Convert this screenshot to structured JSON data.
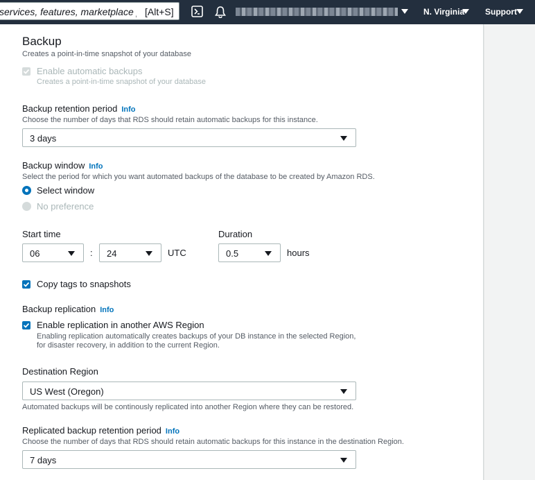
{
  "nav": {
    "search_text": "services, features, marketplace products",
    "search_shortcut": "[Alt+S]",
    "cloudshell_icon": "terminal-icon",
    "notifications_icon": "bell-icon",
    "region": "N. Virginia",
    "support": "Support"
  },
  "backup": {
    "title": "Backup",
    "description": "Creates a point-in-time snapshot of your database",
    "auto_backups": {
      "label": "Enable automatic backups",
      "description": "Creates a point-in-time snapshot of your database",
      "checked": true,
      "disabled": true
    },
    "retention": {
      "label": "Backup retention period",
      "info": "Info",
      "description": "Choose the number of days that RDS should retain automatic backups for this instance.",
      "value": "3 days"
    },
    "window": {
      "label": "Backup window",
      "info": "Info",
      "description": "Select the period for which you want automated backups of the database to be created by Amazon RDS.",
      "option_select": "Select window",
      "option_none": "No preference",
      "selected": "Select window"
    },
    "start_time": {
      "label": "Start time",
      "hour": "06",
      "separator": ":",
      "minute": "24",
      "timezone": "UTC"
    },
    "duration": {
      "label": "Duration",
      "value": "0.5",
      "unit": "hours"
    },
    "copy_tags": {
      "label": "Copy tags to snapshots",
      "checked": true
    },
    "replication": {
      "label": "Backup replication",
      "info": "Info",
      "enable_label": "Enable replication in another AWS Region",
      "enable_desc_1": "Enabling replication automatically creates backups of your DB instance in the selected Region,",
      "enable_desc_2": "for disaster recovery, in addition to the current Region.",
      "checked": true
    },
    "destination": {
      "label": "Destination Region",
      "value": "US West (Oregon)",
      "description": "Automated backups will be continously replicated into another Region where they can be restored."
    },
    "replicated_retention": {
      "label": "Replicated backup retention period",
      "info": "Info",
      "description": "Choose the number of days that RDS should retain automatic backups for this instance in the destination Region.",
      "value": "7 days"
    }
  },
  "colors": {
    "nav_bg": "#232f3e",
    "accent": "#0073bb",
    "link": "#0073bb"
  }
}
